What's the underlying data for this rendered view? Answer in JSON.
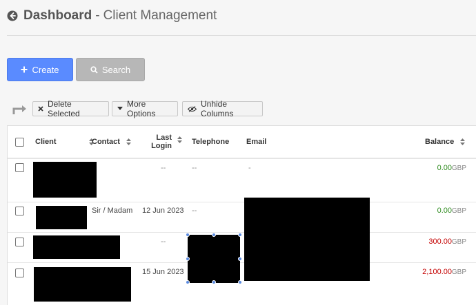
{
  "header": {
    "title": "Dashboard",
    "separator": "-",
    "subtitle": "Client Management",
    "back_icon": "back-arrow-circle-icon"
  },
  "actions": {
    "create_label": "Create",
    "search_label": "Search",
    "create_color": "#5a8bff",
    "search_color": "#b7b7b7"
  },
  "bulk_toolbar": {
    "delete_label": "Delete Selected",
    "more_label": "More Options",
    "unhide_label": "Unhide Columns"
  },
  "table": {
    "columns": {
      "client": "Client",
      "contact": "Contact",
      "last_login_line1": "Last",
      "last_login_line2": "Login",
      "telephone": "Telephone",
      "email": "Email",
      "balance": "Balance"
    },
    "rows": [
      {
        "contact": "",
        "last_login": "--",
        "telephone": "--",
        "email": "-",
        "balance": "0.00",
        "currency": "GBP",
        "balance_status": "positive"
      },
      {
        "contact": "Sir / Madam",
        "last_login": "12 Jun 2023",
        "telephone": "--",
        "email": "",
        "balance": "0.00",
        "currency": "GBP",
        "balance_status": "positive"
      },
      {
        "contact": "",
        "last_login": "--",
        "telephone": "",
        "email": "",
        "balance": "300.00",
        "currency": "GBP",
        "balance_status": "negative"
      },
      {
        "contact": "",
        "last_login": "15 Jun 2023",
        "telephone": "",
        "email": "",
        "balance": "2,100.00",
        "currency": "GBP",
        "balance_status": "negative"
      }
    ]
  },
  "colors": {
    "positive_balance": "#2e8b1e",
    "negative_balance": "#c40000"
  }
}
